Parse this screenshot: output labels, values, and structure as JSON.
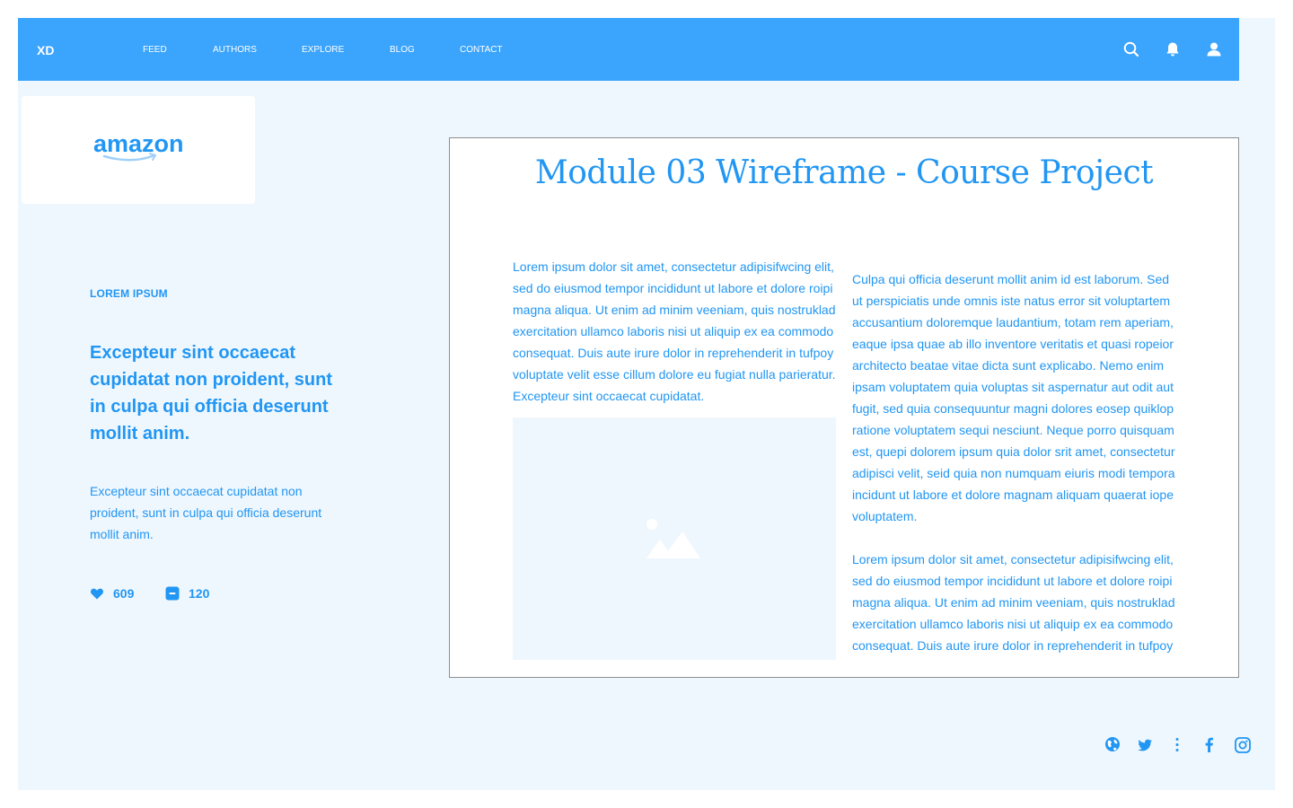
{
  "navbar": {
    "logo": "XD",
    "links": [
      "FEED",
      "AUTHORS",
      "EXPLORE",
      "BLOG",
      "CONTACT"
    ],
    "icons": [
      "search-icon",
      "bell-icon",
      "user-icon"
    ],
    "background": "#3ba4fc"
  },
  "brand": {
    "name": "amazon",
    "logo_icon": "amazon-logo"
  },
  "sidebar": {
    "eyebrow": "LOREM IPSUM",
    "headline": "Excepteur sint occaecat cupidatat non proident, sunt in culpa qui officia deserunt mollit anim.",
    "summary": "Excepteur sint occaecat cupidatat non proident, sunt in culpa qui officia deserunt mollit anim.",
    "likes": "609",
    "comments": "120",
    "accent": "#2196f3"
  },
  "article": {
    "title": "Module 03 Wireframe - Course Project",
    "col1_text": "Lorem ipsum dolor sit amet, consectetur adipisifwcing elit, sed do eiusmod tempor incididunt ut labore et dolore roipi magna aliqua. Ut enim ad minim veeniam, quis nostruklad exercitation ullamco laboris nisi ut aliquip ex ea commodo consequat. Duis aute irure dolor in reprehenderit in tufpoy voluptate velit esse cillum dolore eu fugiat nulla parieratur. Excepteur sint occaecat cupidatat.",
    "col2_para1": "Culpa qui officia deserunt mollit anim id est laborum. Sed ut perspiciatis unde omnis iste natus error sit voluptartem accusantium doloremque laudantium, totam rem aperiam, eaque ipsa quae ab illo inventore veritatis et quasi ropeior architecto beatae vitae dicta sunt explicabo. Nemo enim ipsam voluptatem quia voluptas sit aspernatur aut odit aut fugit, sed quia consequuntur magni dolores eosep quiklop ratione voluptatem sequi nesciunt. Neque porro quisquam est, quepi dolorem ipsum quia dolor srit amet, consectetur adipisci velit, seid quia non numquam eiuris modi tempora incidunt ut labore et dolore magnam aliquam quaerat iope voluptatem.",
    "col2_para2": "Lorem ipsum dolor sit amet, consectetur adipisifwcing elit, sed do eiusmod tempor incididunt ut labore et dolore roipi magna aliqua. Ut enim ad minim veeniam, quis nostruklad exercitation ullamco laboris nisi ut aliquip ex ea commodo consequat. Duis aute irure dolor in reprehenderit in tufpoy",
    "image_icon": "image-placeholder-icon"
  },
  "footer": {
    "icons": [
      "globe-icon",
      "twitter-icon",
      "more-vertical-icon",
      "facebook-icon",
      "instagram-icon"
    ]
  }
}
